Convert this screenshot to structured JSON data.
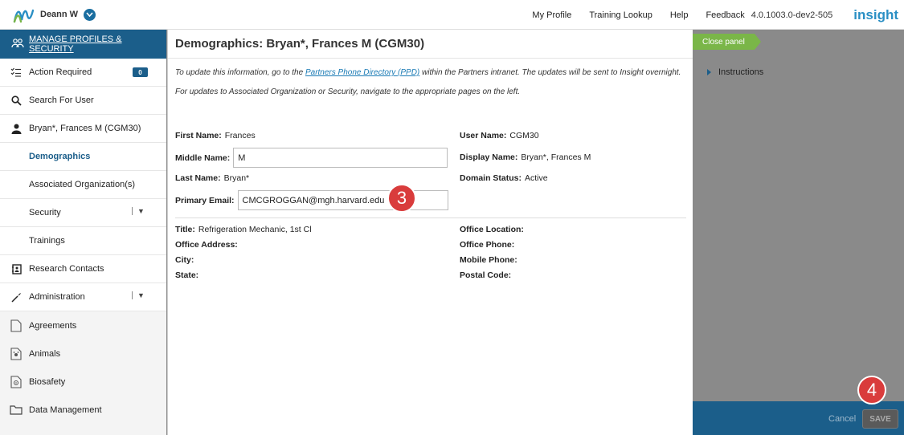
{
  "topbar": {
    "user_name": "Deann W",
    "nav": [
      "My Profile",
      "Training Lookup",
      "Help",
      "Feedback"
    ],
    "version": "4.0.1003.0-dev2-505",
    "brand": "insight"
  },
  "sidebar": {
    "header": "MANAGE PROFILES & SECURITY",
    "action_required": {
      "label": "Action Required",
      "count": "0"
    },
    "search_user": "Search For User",
    "selected_user": "Bryan*, Frances M (CGM30)",
    "sub_items": [
      "Demographics",
      "Associated Organization(s)",
      "Security",
      "Trainings"
    ],
    "research_contacts": "Research Contacts",
    "administration": "Administration",
    "other_items": [
      "Agreements",
      "Animals",
      "Biosafety",
      "Data Management"
    ]
  },
  "panel": {
    "title": "Demographics: Bryan*, Frances M (CGM30)",
    "note1_pre": "To update this information, go to the ",
    "note1_link": "Partners Phone Directory (PPD)",
    "note1_post": " within the Partners intranet. The updates will be sent to Insight overnight.",
    "note2": "For updates to Associated Organization or Security, navigate to the appropriate pages on the left.",
    "fields": {
      "first_name_label": "First Name:",
      "first_name": "Frances",
      "middle_name_label": "Middle Name:",
      "middle_name": "M",
      "last_name_label": "Last Name:",
      "last_name": "Bryan*",
      "primary_email_label": "Primary Email:",
      "primary_email": "CMCGROGGAN@mgh.harvard.edu",
      "user_name_label": "User Name:",
      "user_name": "CGM30",
      "display_name_label": "Display Name:",
      "display_name": "Bryan*, Frances M",
      "domain_status_label": "Domain Status:",
      "domain_status": "Active"
    },
    "info": {
      "title_label": "Title:",
      "title": "Refrigeration Mechanic, 1st Cl",
      "office_address_label": "Office Address:",
      "city_label": "City:",
      "state_label": "State:",
      "office_location_label": "Office Location:",
      "office_phone_label": "Office Phone:",
      "mobile_phone_label": "Mobile Phone:",
      "postal_code_label": "Postal Code:"
    }
  },
  "right": {
    "close_panel": "Close panel",
    "instructions": "Instructions"
  },
  "footer": {
    "cancel": "Cancel",
    "save": "SAVE"
  },
  "callouts": [
    "3",
    "4"
  ]
}
